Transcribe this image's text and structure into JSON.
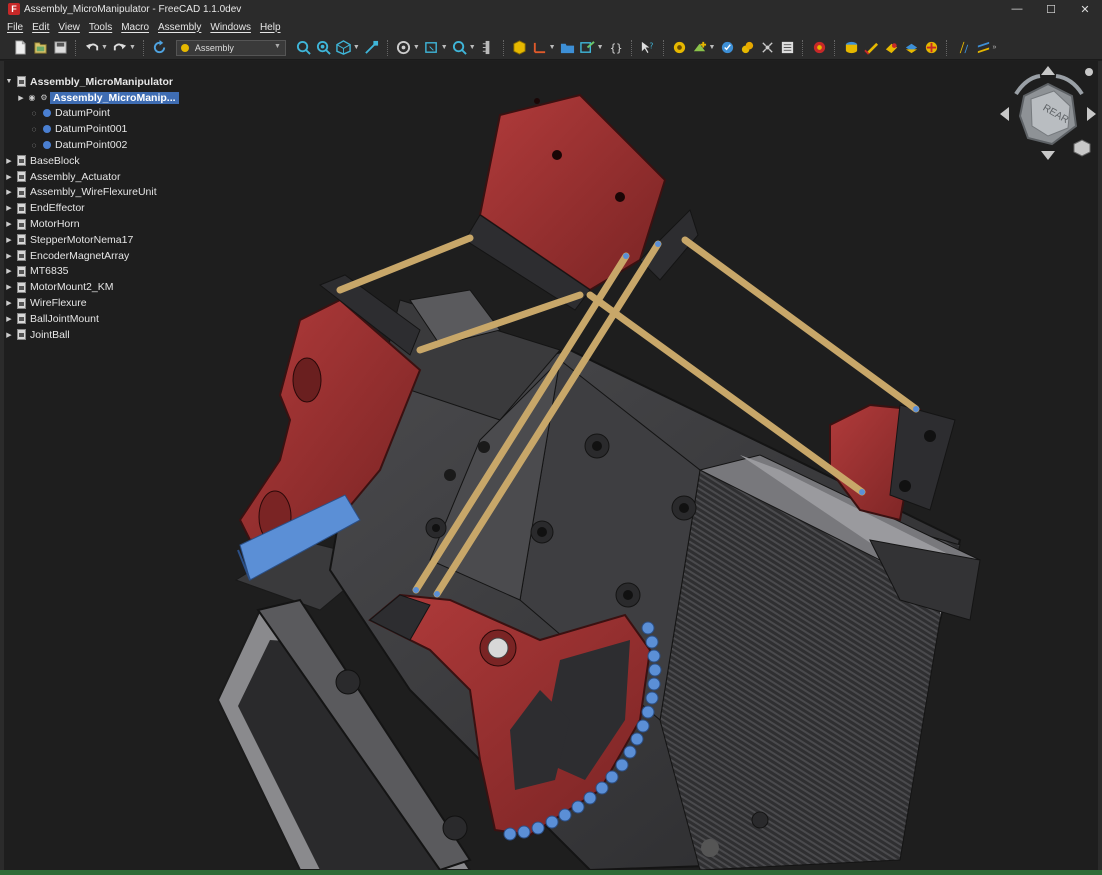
{
  "window": {
    "title": "Assembly_MicroManipulator - FreeCAD 1.1.0dev",
    "app_icon_letter": "F",
    "minimize": "—",
    "maximize": "☐",
    "close": "✕"
  },
  "menu": [
    "File",
    "Edit",
    "View",
    "Tools",
    "Macro",
    "Assembly",
    "Windows",
    "Help"
  ],
  "toolbar": {
    "workbench": "Assembly"
  },
  "tree": {
    "root": "Assembly_MicroManipulator",
    "selected": "Assembly_MicroManip...",
    "datums": [
      "DatumPoint",
      "DatumPoint001",
      "DatumPoint002"
    ],
    "items": [
      "BaseBlock",
      "Assembly_Actuator",
      "Assembly_WireFlexureUnit",
      "EndEffector",
      "MotorHorn",
      "StepperMotorNema17",
      "EncoderMagnetArray",
      "MT6835",
      "MotorMount2_KM",
      "WireFlexure",
      "BallJointMount",
      "JointBall"
    ]
  },
  "navcube": {
    "face_label": "REAR"
  },
  "colors": {
    "part_red": "#9b2f2f",
    "part_dark": "#3a3a3c",
    "rod_tan": "#c8a769",
    "magnet_blue": "#5b8fd6",
    "status_green": "#2f6b37",
    "selection_blue": "#3f6db3"
  }
}
